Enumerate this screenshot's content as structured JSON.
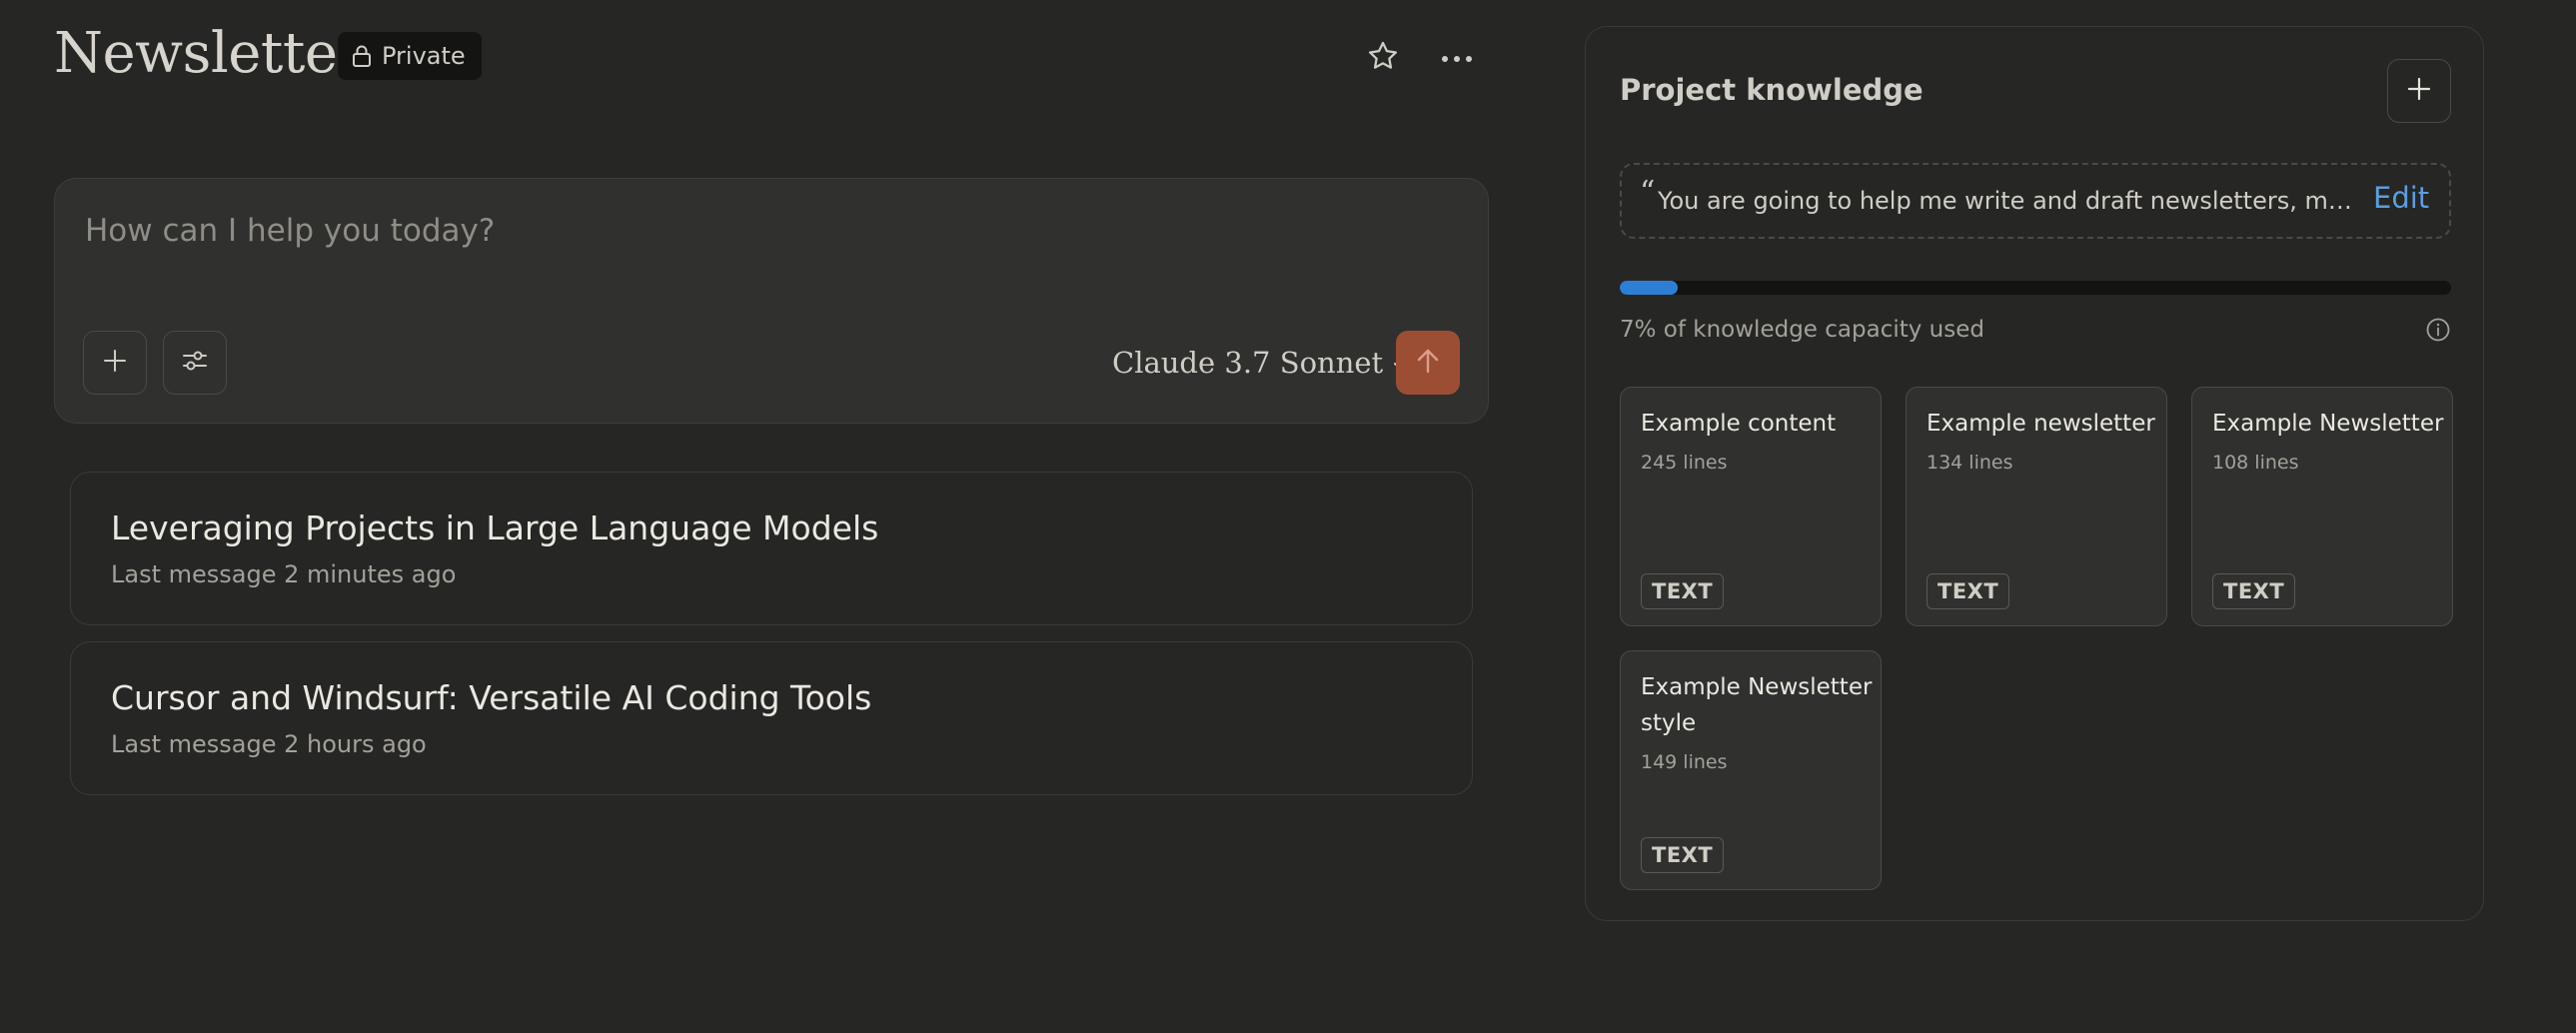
{
  "header": {
    "title": "Newsletter",
    "visibility": "Private"
  },
  "composer": {
    "placeholder": "How can I help you today?",
    "model": "Claude 3.7 Sonnet",
    "send_color": "#9c4e35"
  },
  "conversations": [
    {
      "title": "Leveraging Projects in Large Language Models",
      "meta": "Last message 2 minutes ago"
    },
    {
      "title": "Cursor and Windsurf: Versatile AI Coding Tools",
      "meta": "Last message 2 hours ago"
    }
  ],
  "knowledge": {
    "title": "Project knowledge",
    "quote_mark": "“",
    "instructions": "You are going to help me write and draft newsletters, my nam...",
    "edit_label": "Edit",
    "capacity_percent": 7,
    "capacity_text": "7% of knowledge capacity used",
    "accent_color": "#2d7fd6",
    "files": [
      {
        "name": "Example content",
        "lines": "245 lines",
        "type": "TEXT"
      },
      {
        "name": "Example newsletter",
        "lines": "134 lines",
        "type": "TEXT"
      },
      {
        "name": "Example Newsletter",
        "lines": "108 lines",
        "type": "TEXT"
      },
      {
        "name": "Example Newsletter style",
        "lines": "149 lines",
        "type": "TEXT"
      }
    ]
  }
}
